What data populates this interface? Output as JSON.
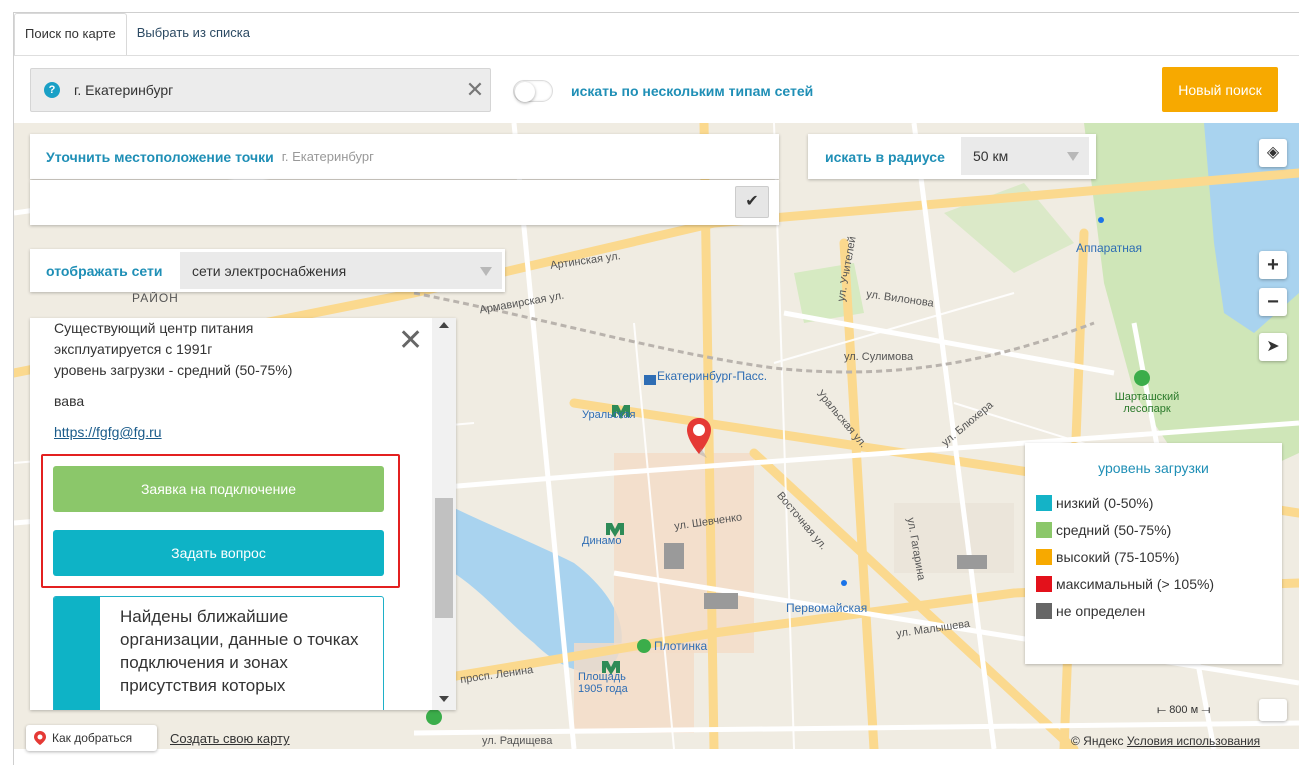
{
  "tabs": [
    {
      "label": "Поиск по карте"
    },
    {
      "label": "Выбрать из списка"
    }
  ],
  "search": {
    "value": "г. Екатеринбург",
    "help_icon": "question-circle-icon",
    "clear_icon": "close-icon"
  },
  "toggle": {
    "label": "искать по нескольким типам сетей",
    "checked": false
  },
  "new_search": {
    "label": "Новый поиск"
  },
  "location": {
    "label": "Уточнить местоположение точки",
    "hint": "г. Екатеринбург",
    "input_value": "",
    "confirm_icon": "checkmark-icon"
  },
  "radius": {
    "label": "искать в радиусе",
    "value": "50 км"
  },
  "networks": {
    "label": "отображать сети",
    "value": "сети электроснабжения"
  },
  "info": {
    "lines": [
      "Существующий центр питания",
      "эксплуатируется с 1991г",
      "уровень загрузки - средний (50-75%)"
    ],
    "name": "вава",
    "link": "https://fgfg@fg.ru",
    "connect_button": "Заявка на подключение",
    "question_button": "Задать вопрос",
    "note": "Найдены ближайшие организации, данные о точках подключения и зонах присутствия которых"
  },
  "legend": {
    "title": "уровень загрузки",
    "items": [
      {
        "label": "низкий (0-50%)",
        "color": "#14b3c7"
      },
      {
        "label": "средний (50-75%)",
        "color": "#8bc76a"
      },
      {
        "label": "высокий (75-105%)",
        "color": "#f7a900"
      },
      {
        "label": "максимальный (> 105%)",
        "color": "#e3111b"
      },
      {
        "label": "не определен",
        "color": "#666666"
      }
    ]
  },
  "map_labels": {
    "station1": "Екатеринбург-Пасс.",
    "metro1": "Уральская",
    "metro2": "Динамо",
    "metro3": "Площадь 1905 года",
    "stop1": "Плотинка",
    "stop2": "Первомайская",
    "stop3": "Аппаратная",
    "park": "Шарташский лесопарк",
    "street1": "ул. Вилонова",
    "street2": "ул. Сулимова",
    "street3": "Артинская ул.",
    "street4": "Армавирская ул.",
    "street5": "ул. Шевченко",
    "street6": "Восточная ул.",
    "street7": "ул. Малышева",
    "street8": "просп. Ленина",
    "street9": "Уральская ул.",
    "street10": "ул. Блюхера",
    "street11": "ул. Гагарина",
    "street12": "ул. Учителей",
    "street13": "ул. Радищева",
    "district": "РАЙОН"
  },
  "controls": {
    "layers_icon": "layers-icon",
    "zoom_in_icon": "zoom-in-icon",
    "zoom_out_icon": "zoom-out-icon",
    "geolocate_icon": "geolocate-arrow-icon",
    "ruler_icon": "ruler-icon"
  },
  "bottom": {
    "route": "Как добраться",
    "create_map": "Создать свою карту",
    "copyright_prefix": "© Яндекс",
    "terms": "Условия использования",
    "scale": "800 м"
  },
  "colors": {
    "accent": "#1f8fb6",
    "orange": "#f7a900",
    "green": "#8bc76a",
    "teal": "#0eb3c6",
    "highlight": "#e32020"
  }
}
